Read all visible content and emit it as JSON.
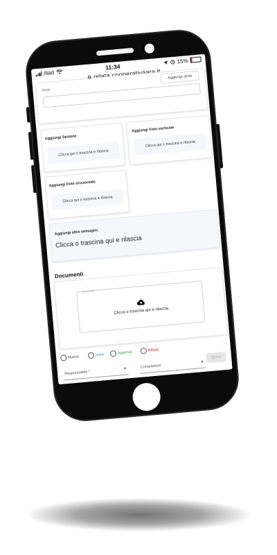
{
  "status_bar": {
    "carrier": "Iliad",
    "time": "11:34",
    "battery": "15%",
    "battery_level": 0.15
  },
  "browser": {
    "url": "qdata.cooperativaara.it"
  },
  "form": {
    "strati": {
      "label": "Strati",
      "add_button": "Aggiungi strati"
    },
    "sezione": {
      "label": "Aggiungi Sezione",
      "drop_text": "Clicca qui o trascina e rilascia"
    },
    "foto_verticale": {
      "label": "Aggiungi Foto verticale",
      "drop_text": "Clicca qui o trascina e rilascia"
    },
    "foto_orizzontale": {
      "label": "Aggiungi Foto orizzontale",
      "drop_text": "Clicca qui o trascina e rilascia"
    },
    "altre_immagini": {
      "label": "Aggiungi altre immagini",
      "drop_text": "Clicca o trascina qui e rilascia"
    },
    "documenti": {
      "title": "Documenti",
      "field_label": "Documenti",
      "drop_text": "Clicca o trascina qui e rilascia"
    },
    "status_options": [
      {
        "label": "Nuovo",
        "color": "#333333"
      },
      {
        "label": "Invia",
        "color": "#2f86d6"
      },
      {
        "label": "Approva",
        "color": "#2e9e3a"
      },
      {
        "label": "Rifiuta",
        "color": "#e02020"
      }
    ],
    "responsabile": {
      "placeholder": "Responsabile *"
    },
    "compilatore": {
      "placeholder": "Compilatore"
    },
    "save_label": "Salva"
  },
  "icons": {
    "upload": "cloud-upload-icon",
    "wifi": "wifi-icon",
    "lock": "lock-icon",
    "location": "location-arrow-icon",
    "alarm": "alarm-icon"
  }
}
